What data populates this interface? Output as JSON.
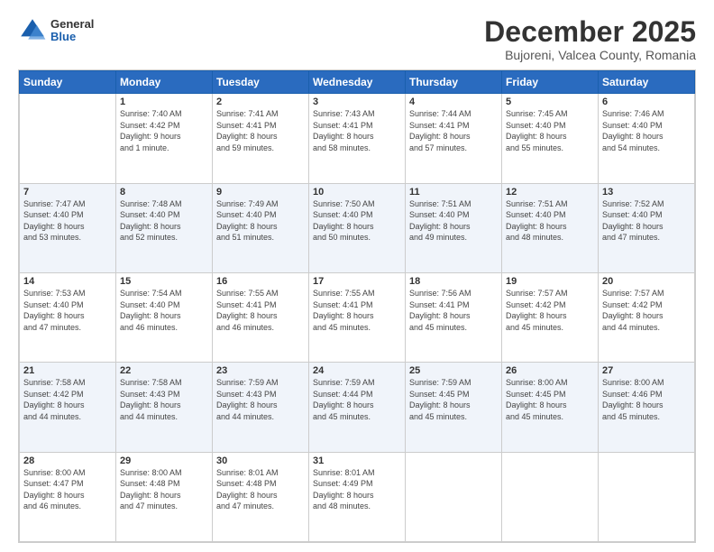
{
  "header": {
    "logo": {
      "general": "General",
      "blue": "Blue"
    },
    "title": "December 2025",
    "subtitle": "Bujoreni, Valcea County, Romania"
  },
  "calendar": {
    "days_of_week": [
      "Sunday",
      "Monday",
      "Tuesday",
      "Wednesday",
      "Thursday",
      "Friday",
      "Saturday"
    ],
    "weeks": [
      [
        {
          "day": "",
          "info": ""
        },
        {
          "day": "1",
          "info": "Sunrise: 7:40 AM\nSunset: 4:42 PM\nDaylight: 9 hours\nand 1 minute."
        },
        {
          "day": "2",
          "info": "Sunrise: 7:41 AM\nSunset: 4:41 PM\nDaylight: 8 hours\nand 59 minutes."
        },
        {
          "day": "3",
          "info": "Sunrise: 7:43 AM\nSunset: 4:41 PM\nDaylight: 8 hours\nand 58 minutes."
        },
        {
          "day": "4",
          "info": "Sunrise: 7:44 AM\nSunset: 4:41 PM\nDaylight: 8 hours\nand 57 minutes."
        },
        {
          "day": "5",
          "info": "Sunrise: 7:45 AM\nSunset: 4:40 PM\nDaylight: 8 hours\nand 55 minutes."
        },
        {
          "day": "6",
          "info": "Sunrise: 7:46 AM\nSunset: 4:40 PM\nDaylight: 8 hours\nand 54 minutes."
        }
      ],
      [
        {
          "day": "7",
          "info": "Sunrise: 7:47 AM\nSunset: 4:40 PM\nDaylight: 8 hours\nand 53 minutes."
        },
        {
          "day": "8",
          "info": "Sunrise: 7:48 AM\nSunset: 4:40 PM\nDaylight: 8 hours\nand 52 minutes."
        },
        {
          "day": "9",
          "info": "Sunrise: 7:49 AM\nSunset: 4:40 PM\nDaylight: 8 hours\nand 51 minutes."
        },
        {
          "day": "10",
          "info": "Sunrise: 7:50 AM\nSunset: 4:40 PM\nDaylight: 8 hours\nand 50 minutes."
        },
        {
          "day": "11",
          "info": "Sunrise: 7:51 AM\nSunset: 4:40 PM\nDaylight: 8 hours\nand 49 minutes."
        },
        {
          "day": "12",
          "info": "Sunrise: 7:51 AM\nSunset: 4:40 PM\nDaylight: 8 hours\nand 48 minutes."
        },
        {
          "day": "13",
          "info": "Sunrise: 7:52 AM\nSunset: 4:40 PM\nDaylight: 8 hours\nand 47 minutes."
        }
      ],
      [
        {
          "day": "14",
          "info": "Sunrise: 7:53 AM\nSunset: 4:40 PM\nDaylight: 8 hours\nand 47 minutes."
        },
        {
          "day": "15",
          "info": "Sunrise: 7:54 AM\nSunset: 4:40 PM\nDaylight: 8 hours\nand 46 minutes."
        },
        {
          "day": "16",
          "info": "Sunrise: 7:55 AM\nSunset: 4:41 PM\nDaylight: 8 hours\nand 46 minutes."
        },
        {
          "day": "17",
          "info": "Sunrise: 7:55 AM\nSunset: 4:41 PM\nDaylight: 8 hours\nand 45 minutes."
        },
        {
          "day": "18",
          "info": "Sunrise: 7:56 AM\nSunset: 4:41 PM\nDaylight: 8 hours\nand 45 minutes."
        },
        {
          "day": "19",
          "info": "Sunrise: 7:57 AM\nSunset: 4:42 PM\nDaylight: 8 hours\nand 45 minutes."
        },
        {
          "day": "20",
          "info": "Sunrise: 7:57 AM\nSunset: 4:42 PM\nDaylight: 8 hours\nand 44 minutes."
        }
      ],
      [
        {
          "day": "21",
          "info": "Sunrise: 7:58 AM\nSunset: 4:42 PM\nDaylight: 8 hours\nand 44 minutes."
        },
        {
          "day": "22",
          "info": "Sunrise: 7:58 AM\nSunset: 4:43 PM\nDaylight: 8 hours\nand 44 minutes."
        },
        {
          "day": "23",
          "info": "Sunrise: 7:59 AM\nSunset: 4:43 PM\nDaylight: 8 hours\nand 44 minutes."
        },
        {
          "day": "24",
          "info": "Sunrise: 7:59 AM\nSunset: 4:44 PM\nDaylight: 8 hours\nand 45 minutes."
        },
        {
          "day": "25",
          "info": "Sunrise: 7:59 AM\nSunset: 4:45 PM\nDaylight: 8 hours\nand 45 minutes."
        },
        {
          "day": "26",
          "info": "Sunrise: 8:00 AM\nSunset: 4:45 PM\nDaylight: 8 hours\nand 45 minutes."
        },
        {
          "day": "27",
          "info": "Sunrise: 8:00 AM\nSunset: 4:46 PM\nDaylight: 8 hours\nand 45 minutes."
        }
      ],
      [
        {
          "day": "28",
          "info": "Sunrise: 8:00 AM\nSunset: 4:47 PM\nDaylight: 8 hours\nand 46 minutes."
        },
        {
          "day": "29",
          "info": "Sunrise: 8:00 AM\nSunset: 4:48 PM\nDaylight: 8 hours\nand 47 minutes."
        },
        {
          "day": "30",
          "info": "Sunrise: 8:01 AM\nSunset: 4:48 PM\nDaylight: 8 hours\nand 47 minutes."
        },
        {
          "day": "31",
          "info": "Sunrise: 8:01 AM\nSunset: 4:49 PM\nDaylight: 8 hours\nand 48 minutes."
        },
        {
          "day": "",
          "info": ""
        },
        {
          "day": "",
          "info": ""
        },
        {
          "day": "",
          "info": ""
        }
      ]
    ]
  }
}
